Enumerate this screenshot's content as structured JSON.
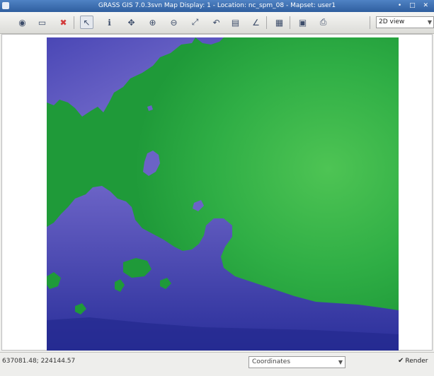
{
  "window": {
    "title": "GRASS GIS 7.0.3svn Map Display: 1 - Location: nc_spm_08 - Mapset: user1",
    "controls": "• □ ✕"
  },
  "toolbar": {
    "buttons": [
      {
        "name": "display-map-icon",
        "glyph": "◉"
      },
      {
        "name": "render-map-icon",
        "glyph": "▭"
      },
      {
        "name": "erase-display-icon",
        "glyph": "✖"
      },
      {
        "name": "pointer-icon",
        "glyph": "↖"
      },
      {
        "name": "query-icon",
        "glyph": "ℹ"
      },
      {
        "name": "pan-icon",
        "glyph": "✥"
      },
      {
        "name": "zoom-in-icon",
        "glyph": "⊕"
      },
      {
        "name": "zoom-out-icon",
        "glyph": "⊖"
      },
      {
        "name": "zoom-extent-icon",
        "glyph": "⤢"
      },
      {
        "name": "zoom-back-icon",
        "glyph": "↶"
      },
      {
        "name": "zoom-menu-icon",
        "glyph": "▤"
      },
      {
        "name": "analyze-icon",
        "glyph": "∠"
      },
      {
        "name": "overlay-icon",
        "glyph": "▦"
      },
      {
        "name": "save-image-icon",
        "glyph": "▣"
      },
      {
        "name": "print-icon",
        "glyph": "⎙"
      }
    ],
    "view_mode": "2D view",
    "colors": {
      "icon": "#3d4d6a",
      "active_bg": "#e4e8ee"
    }
  },
  "map": {
    "layer": "elevation raster",
    "colors": {
      "low": "#2a2f9a",
      "low_mid": "#6b63c6",
      "mid": "#1f9a39",
      "high": "#4ec454"
    }
  },
  "statusbar": {
    "coordinates": "637081.48; 224144.57",
    "mode": "Coordinates",
    "render_label": "Render",
    "render_checked": true
  }
}
